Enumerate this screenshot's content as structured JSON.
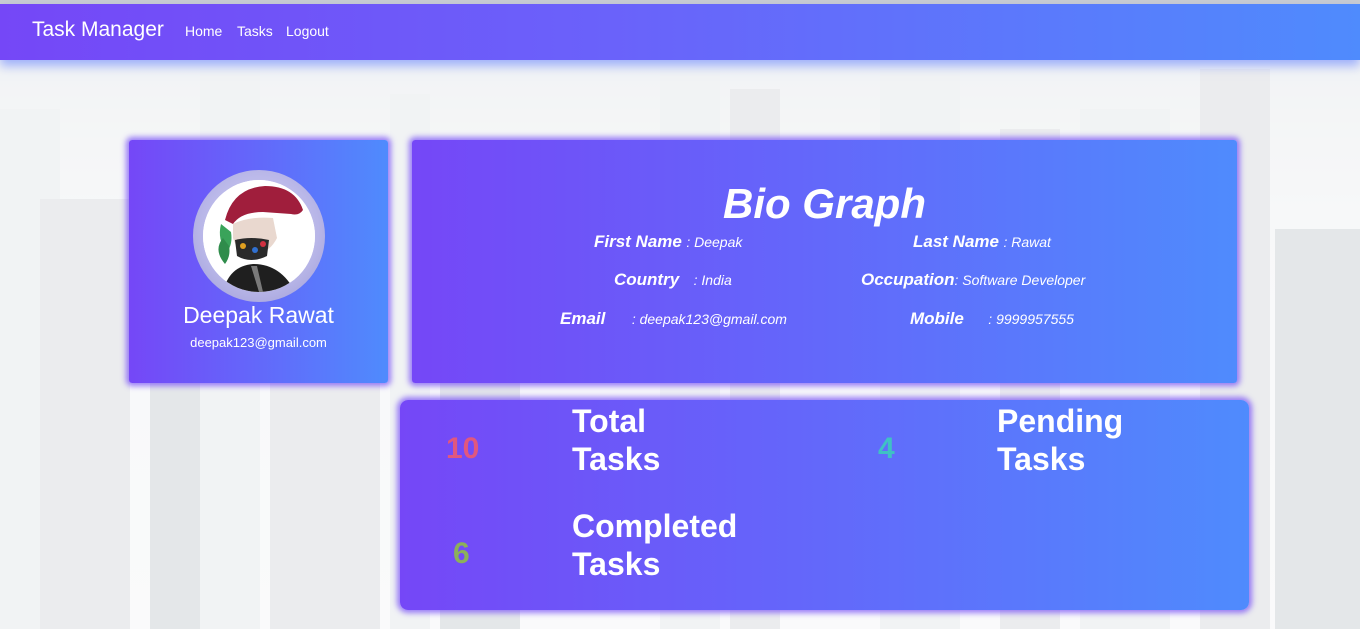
{
  "navbar": {
    "brand": "Task Manager",
    "links": [
      "Home",
      "Tasks",
      "Logout"
    ]
  },
  "profile": {
    "name": "Deepak Rawat",
    "email": "deepak123@gmail.com",
    "avatar_icon": "user-avatar-icon"
  },
  "bio": {
    "title": "Bio Graph",
    "fields": {
      "first_name": {
        "label": "First Name",
        "value": ": Deepak"
      },
      "last_name": {
        "label": "Last Name",
        "value": ": Rawat"
      },
      "country": {
        "label": "Country",
        "value": ": India"
      },
      "occupation": {
        "label": "Occupation",
        "value": ": Software Developer"
      },
      "email": {
        "label": "Email",
        "value": ": deepak123@gmail.com"
      },
      "mobile": {
        "label": "Mobile",
        "value": ": 9999957555"
      }
    }
  },
  "stats": {
    "total": {
      "count": "10",
      "label_line1": "Total",
      "label_line2": "Tasks",
      "color": "#e0577f"
    },
    "pending": {
      "count": "4",
      "label_line1": "Pending",
      "label_line2": "Tasks",
      "color": "#3fc1c4"
    },
    "completed": {
      "count": "6",
      "label_line1": "Completed",
      "label_line2": "Tasks",
      "color": "#8cb05a"
    }
  },
  "colors": {
    "gradient_start": "#7547f7",
    "gradient_end": "#4f8bfd"
  }
}
